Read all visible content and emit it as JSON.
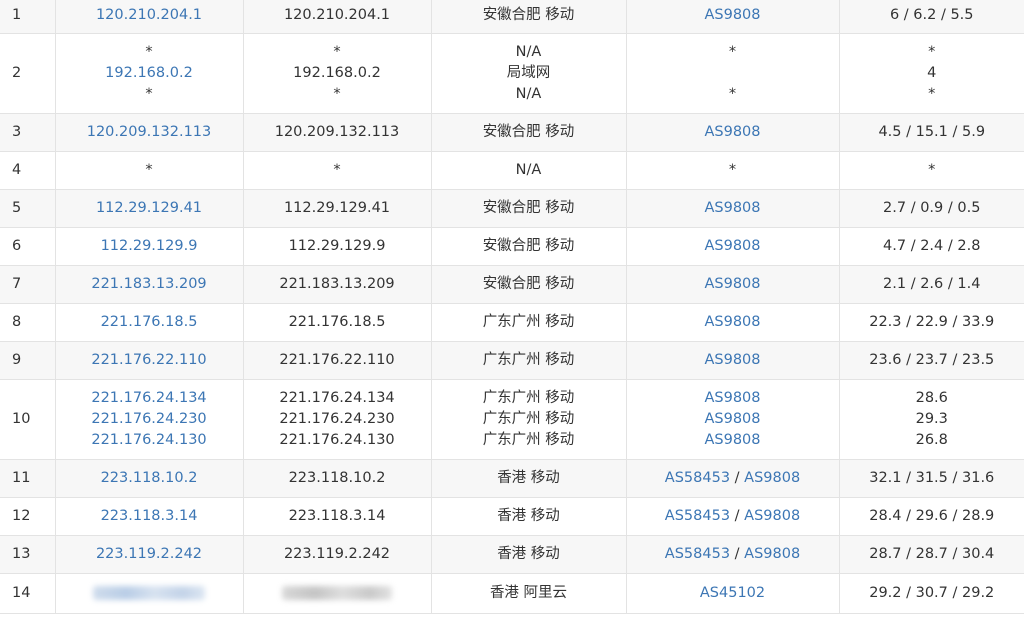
{
  "rows": [
    {
      "hop": "1",
      "ip": [
        "120.210.204.1"
      ],
      "host": [
        "120.210.204.1"
      ],
      "location": [
        "安徽合肥 移动"
      ],
      "asn": [
        [
          "AS9808"
        ]
      ],
      "latency": [
        "6 / 6.2 / 5.5"
      ]
    },
    {
      "hop": "2",
      "ip": [
        "*",
        "192.168.0.2",
        "*"
      ],
      "host": [
        "*",
        "192.168.0.2",
        "*"
      ],
      "location": [
        "N/A",
        "局域网",
        "N/A"
      ],
      "asn": [
        [
          "*"
        ],
        [],
        [
          "*"
        ]
      ],
      "latency": [
        "*",
        "4",
        "*"
      ]
    },
    {
      "hop": "3",
      "ip": [
        "120.209.132.113"
      ],
      "host": [
        "120.209.132.113"
      ],
      "location": [
        "安徽合肥 移动"
      ],
      "asn": [
        [
          "AS9808"
        ]
      ],
      "latency": [
        "4.5 / 15.1 / 5.9"
      ]
    },
    {
      "hop": "4",
      "ip": [
        "*"
      ],
      "host": [
        "*"
      ],
      "location": [
        "N/A"
      ],
      "asn": [
        [
          "*"
        ]
      ],
      "latency": [
        "*"
      ]
    },
    {
      "hop": "5",
      "ip": [
        "112.29.129.41"
      ],
      "host": [
        "112.29.129.41"
      ],
      "location": [
        "安徽合肥 移动"
      ],
      "asn": [
        [
          "AS9808"
        ]
      ],
      "latency": [
        "2.7 / 0.9 / 0.5"
      ]
    },
    {
      "hop": "6",
      "ip": [
        "112.29.129.9"
      ],
      "host": [
        "112.29.129.9"
      ],
      "location": [
        "安徽合肥 移动"
      ],
      "asn": [
        [
          "AS9808"
        ]
      ],
      "latency": [
        "4.7 / 2.4 / 2.8"
      ]
    },
    {
      "hop": "7",
      "ip": [
        "221.183.13.209"
      ],
      "host": [
        "221.183.13.209"
      ],
      "location": [
        "安徽合肥 移动"
      ],
      "asn": [
        [
          "AS9808"
        ]
      ],
      "latency": [
        "2.1 / 2.6 / 1.4"
      ]
    },
    {
      "hop": "8",
      "ip": [
        "221.176.18.5"
      ],
      "host": [
        "221.176.18.5"
      ],
      "location": [
        "广东广州 移动"
      ],
      "asn": [
        [
          "AS9808"
        ]
      ],
      "latency": [
        "22.3 / 22.9 / 33.9"
      ]
    },
    {
      "hop": "9",
      "ip": [
        "221.176.22.110"
      ],
      "host": [
        "221.176.22.110"
      ],
      "location": [
        "广东广州 移动"
      ],
      "asn": [
        [
          "AS9808"
        ]
      ],
      "latency": [
        "23.6 / 23.7 / 23.5"
      ]
    },
    {
      "hop": "10",
      "ip": [
        "221.176.24.134",
        "221.176.24.230",
        "221.176.24.130"
      ],
      "host": [
        "221.176.24.134",
        "221.176.24.230",
        "221.176.24.130"
      ],
      "location": [
        "广东广州 移动",
        "广东广州 移动",
        "广东广州 移动"
      ],
      "asn": [
        [
          "AS9808"
        ],
        [
          "AS9808"
        ],
        [
          "AS9808"
        ]
      ],
      "latency": [
        "28.6",
        "29.3",
        "26.8"
      ]
    },
    {
      "hop": "11",
      "ip": [
        "223.118.10.2"
      ],
      "host": [
        "223.118.10.2"
      ],
      "location": [
        "香港 移动"
      ],
      "asn": [
        [
          "AS58453",
          "AS9808"
        ]
      ],
      "latency": [
        "32.1 / 31.5 / 31.6"
      ]
    },
    {
      "hop": "12",
      "ip": [
        "223.118.3.14"
      ],
      "host": [
        "223.118.3.14"
      ],
      "location": [
        "香港 移动"
      ],
      "asn": [
        [
          "AS58453",
          "AS9808"
        ]
      ],
      "latency": [
        "28.4 / 29.6 / 28.9"
      ]
    },
    {
      "hop": "13",
      "ip": [
        "223.119.2.242"
      ],
      "host": [
        "223.119.2.242"
      ],
      "location": [
        "香港 移动"
      ],
      "asn": [
        [
          "AS58453",
          "AS9808"
        ]
      ],
      "latency": [
        "28.7 / 28.7 / 30.4"
      ]
    },
    {
      "hop": "14",
      "ip": [],
      "host": [],
      "ip_redacted": true,
      "location": [
        "香港 阿里云"
      ],
      "asn": [
        [
          "AS45102"
        ]
      ],
      "latency": [
        "29.2 / 30.7 / 29.2"
      ]
    }
  ],
  "asn_separator": " / ",
  "colors": {
    "link": "#3c76b4",
    "text": "#333333",
    "row_alt": "#f7f7f7",
    "border": "#e3e3e3"
  }
}
